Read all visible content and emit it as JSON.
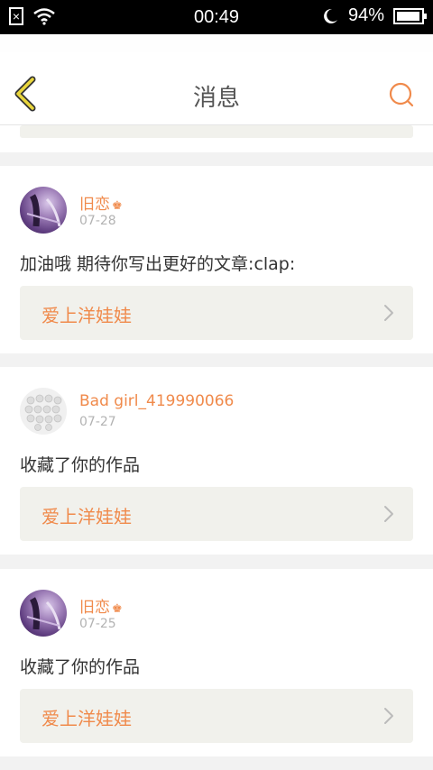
{
  "status_bar": {
    "sim_label": "×",
    "time": "00:49",
    "battery": "94%",
    "battery_level": 0.94
  },
  "header": {
    "title": "消息"
  },
  "colors": {
    "accent": "#f08a4b",
    "back_arrow": "#e9d63c",
    "link_bg": "#f1f1ec"
  },
  "messages": [
    {
      "username": "旧恋",
      "has_crown": true,
      "date": "07-28",
      "text": "加油哦 期待你写出更好的文章:clap:",
      "link_label": "爱上洋娃娃",
      "avatar": "purple-avatar"
    },
    {
      "username": "Bad girl_419990066",
      "has_crown": false,
      "date": "07-27",
      "text": "收藏了你的作品",
      "link_label": "爱上洋娃娃",
      "avatar": "grid-avatar"
    },
    {
      "username": "旧恋",
      "has_crown": true,
      "date": "07-25",
      "text": "收藏了你的作品",
      "link_label": "爱上洋娃娃",
      "avatar": "purple-avatar"
    }
  ],
  "icons": {
    "back": "chevron-left-icon",
    "search": "search-icon",
    "crown": "♚",
    "link_chevron": "chevron-right-icon"
  }
}
